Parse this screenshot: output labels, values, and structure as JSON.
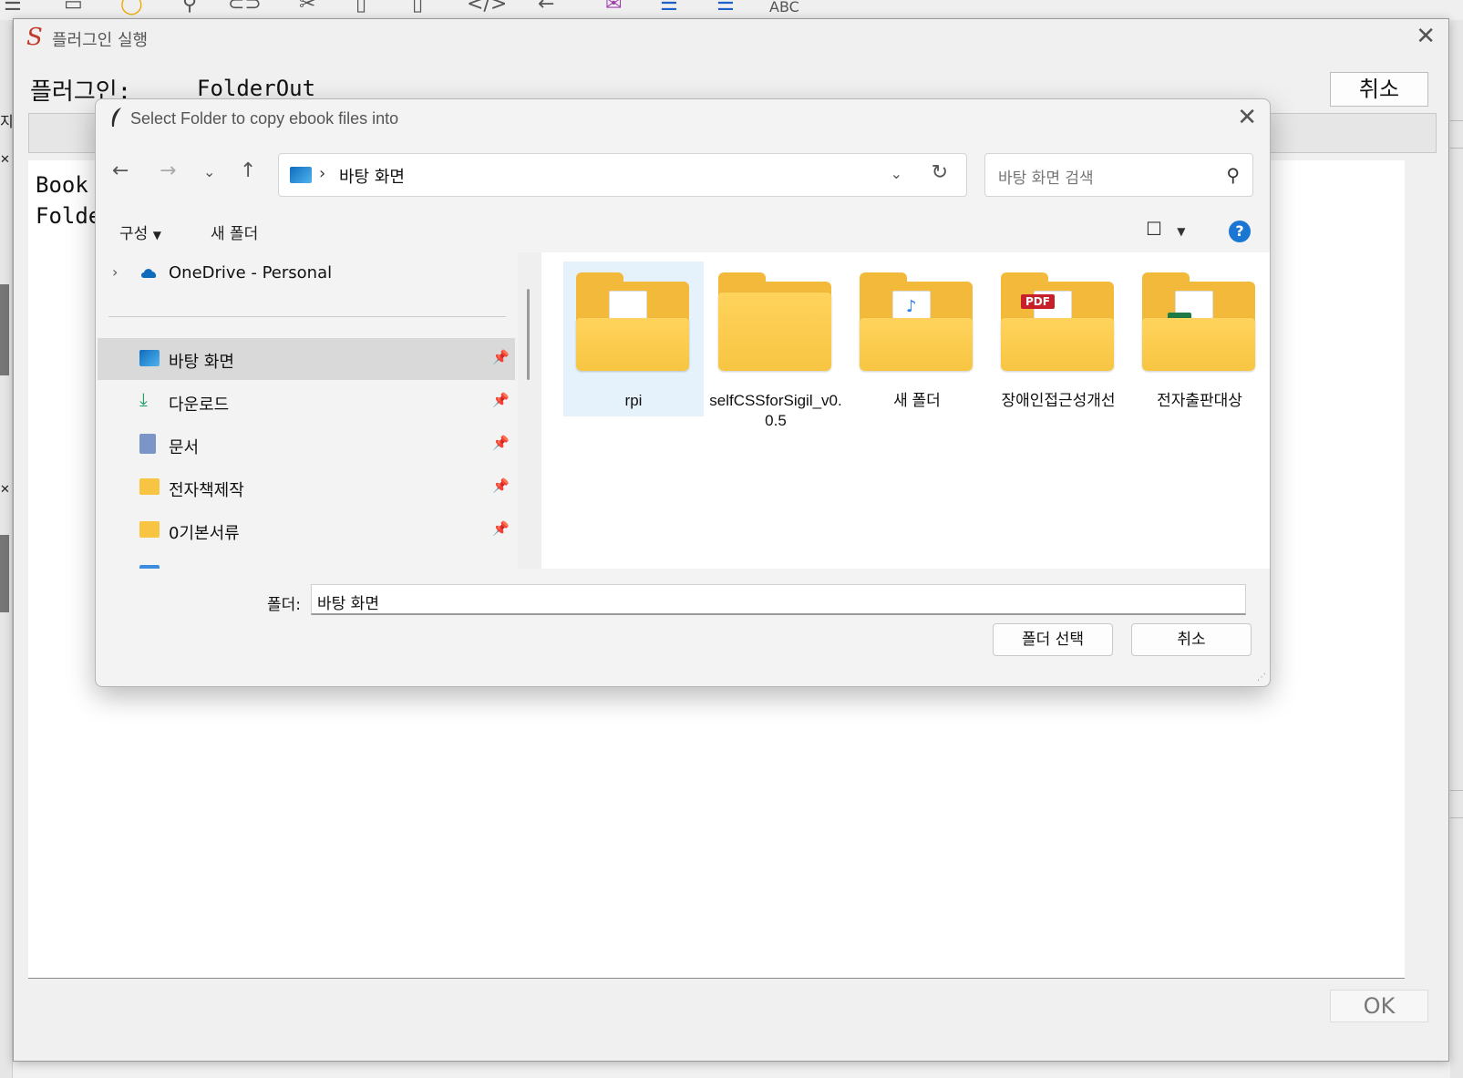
{
  "plugin_window": {
    "title": "플러그인 실행",
    "plugin_label": "플러그인:",
    "plugin_name": "FolderOut",
    "cancel_label": "취소",
    "log_lines": [
      "Book",
      "Folde"
    ],
    "ok_label": "OK"
  },
  "dialog": {
    "title": "Select Folder to copy ebook files into",
    "address_path": "바탕 화면",
    "search_placeholder": "바탕 화면 검색",
    "organize_label": "구성",
    "new_folder_label": "새 폴더",
    "help_label": "?",
    "nav_items": [
      {
        "label": "OneDrive - Personal",
        "icon": "cloud-icon"
      },
      {
        "label": "바탕 화면",
        "icon": "desktop-icon",
        "pinned": true,
        "selected": true
      },
      {
        "label": "다운로드",
        "icon": "download-icon",
        "pinned": true
      },
      {
        "label": "문서",
        "icon": "document-icon",
        "pinned": true
      },
      {
        "label": "전자책제작",
        "icon": "folder-icon",
        "pinned": true
      },
      {
        "label": "0기본서류",
        "icon": "folder-icon",
        "pinned": true
      }
    ],
    "files": [
      {
        "name": "rpi",
        "selected": true
      },
      {
        "name": "selfCSSforSigil_v0.0.5"
      },
      {
        "name": "새 폴더"
      },
      {
        "name": "장애인접근성개선",
        "badge": "PDF"
      },
      {
        "name": "전자출판대상"
      }
    ],
    "folder_field_label": "폴더:",
    "folder_field_value": "바탕 화면",
    "select_folder_label": "폴더 선택",
    "cancel_label": "취소"
  },
  "colors": {
    "accent": "#1976d2",
    "folder": "#f7c542",
    "selection": "#e5f1fb"
  }
}
